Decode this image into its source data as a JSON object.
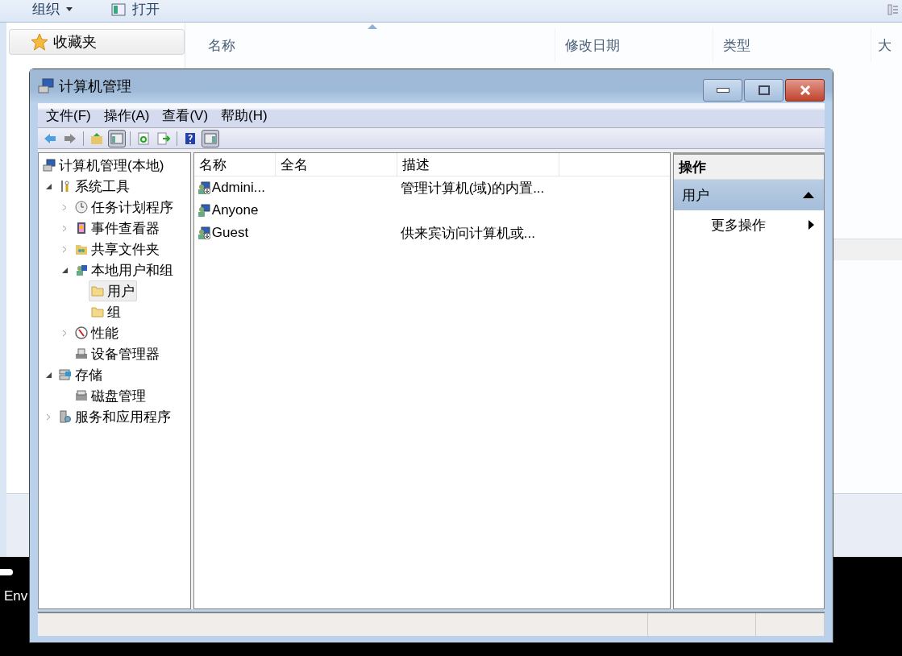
{
  "background_window": {
    "toolbar": [
      {
        "label": "组织",
        "kind": "dropdown"
      },
      {
        "label": "打开",
        "kind": "open"
      }
    ],
    "sidebar": {
      "favorites": "收藏夹"
    },
    "columns": [
      "名称",
      "修改日期",
      "类型",
      "大"
    ]
  },
  "terminal": {
    "text": "Env"
  },
  "window": {
    "title": "计算机管理",
    "menu": [
      "文件(F)",
      "操作(A)",
      "查看(V)",
      "帮助(H)"
    ],
    "tree": [
      {
        "label": "计算机管理(本地)",
        "kind": "computer",
        "selected": false,
        "children": [
          {
            "label": "系统工具",
            "kind": "tools",
            "expanded": true,
            "selected": false,
            "children": [
              {
                "label": "任务计划程序",
                "kind": "clock",
                "expanded": false,
                "selected": false
              },
              {
                "label": "事件查看器",
                "kind": "log",
                "expanded": false,
                "selected": false
              },
              {
                "label": "共享文件夹",
                "kind": "share",
                "expanded": false,
                "selected": false
              },
              {
                "label": "本地用户和组",
                "kind": "users",
                "expanded": true,
                "selected": false,
                "children": [
                  {
                    "label": "用户",
                    "kind": "folder",
                    "selected": true
                  },
                  {
                    "label": "组",
                    "kind": "folder",
                    "selected": false
                  }
                ]
              },
              {
                "label": "性能",
                "kind": "perf",
                "expanded": false,
                "selected": false
              },
              {
                "label": "设备管理器",
                "kind": "device",
                "selected": false
              }
            ]
          },
          {
            "label": "存储",
            "kind": "storage",
            "expanded": true,
            "selected": false,
            "children": [
              {
                "label": "磁盘管理",
                "kind": "disk",
                "selected": false
              }
            ]
          },
          {
            "label": "服务和应用程序",
            "kind": "services",
            "expanded": false,
            "selected": false
          }
        ]
      }
    ],
    "list": {
      "columns": [
        "名称",
        "全名",
        "描述"
      ],
      "rows": [
        {
          "name": "Admini...",
          "description": "管理计算机(域)的内置...",
          "disabled": true
        },
        {
          "name": "Anyone",
          "disabled": false
        },
        {
          "name": "Guest",
          "description": "供来宾访问计算机或...",
          "disabled": true
        }
      ]
    },
    "actions": {
      "header": "操作",
      "sections": [
        {
          "label": "用户",
          "expanded": true,
          "items": [
            "更多操作"
          ]
        }
      ]
    }
  }
}
